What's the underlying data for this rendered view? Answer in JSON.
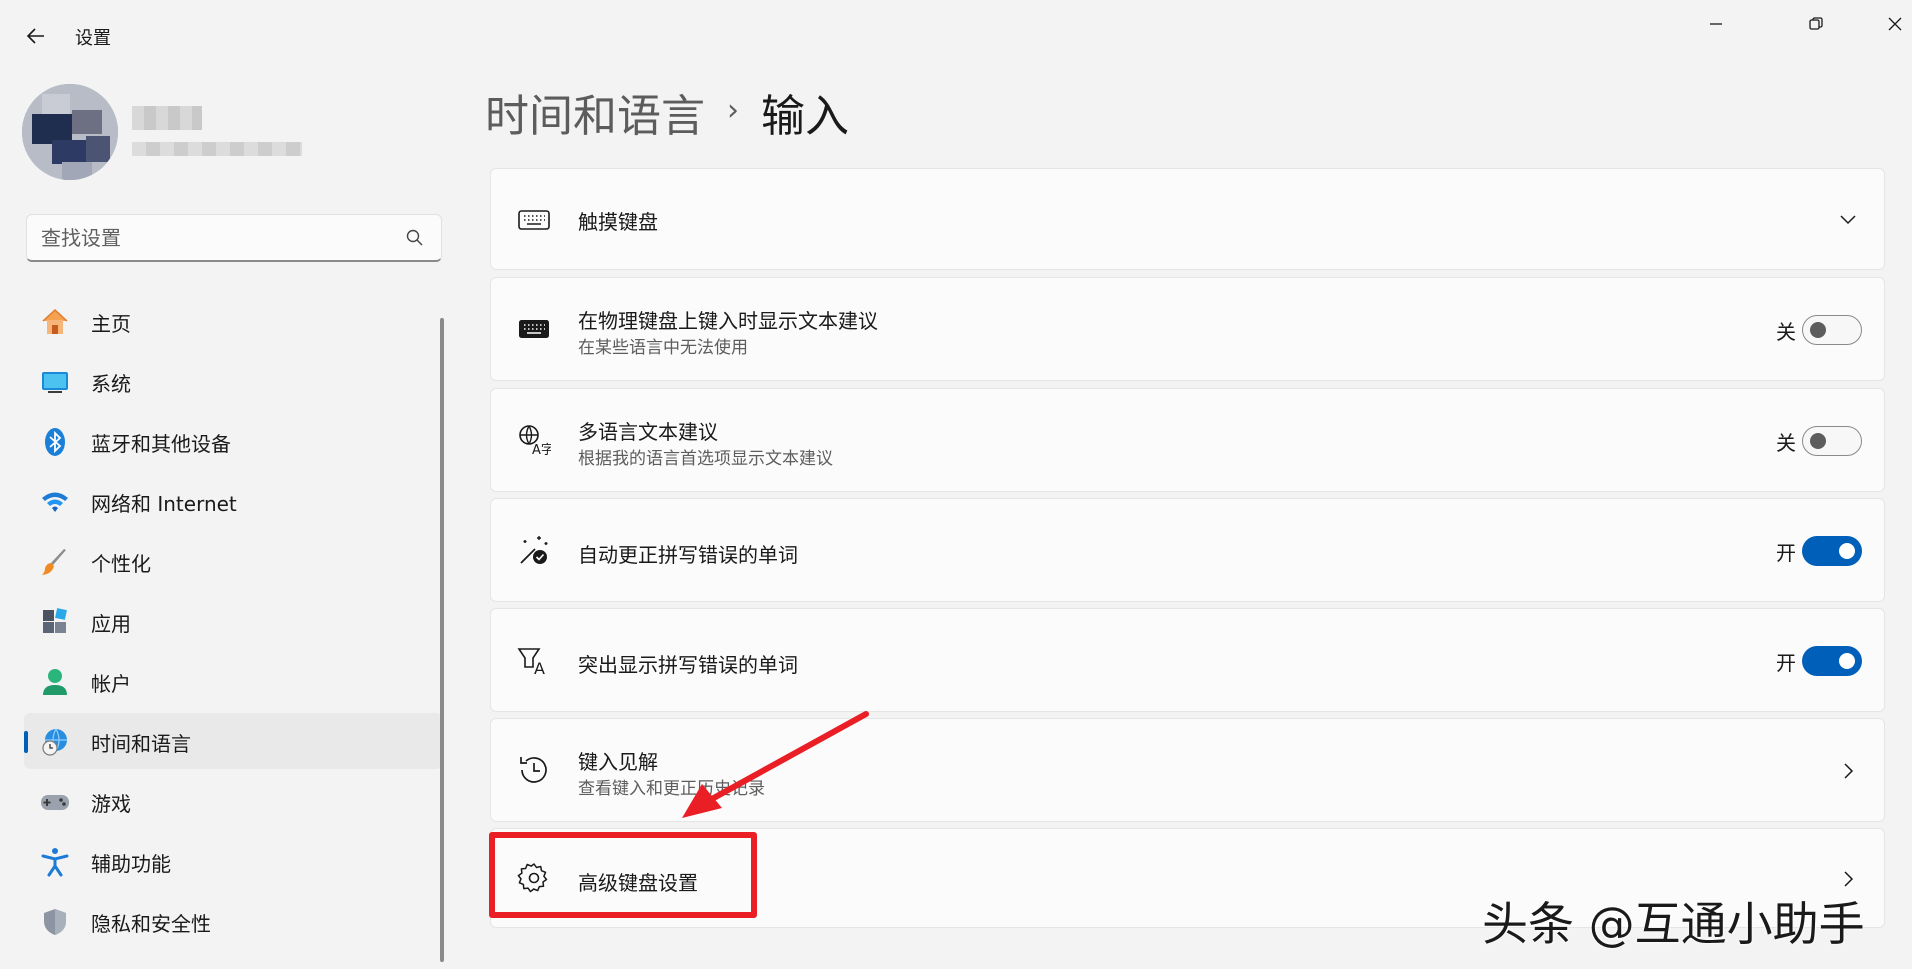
{
  "window": {
    "title": "设置"
  },
  "search": {
    "placeholder": "查找设置"
  },
  "sidebar": {
    "items": [
      {
        "label": "主页"
      },
      {
        "label": "系统"
      },
      {
        "label": "蓝牙和其他设备"
      },
      {
        "label": "网络和 Internet"
      },
      {
        "label": "个性化"
      },
      {
        "label": "应用"
      },
      {
        "label": "帐户"
      },
      {
        "label": "时间和语言",
        "active": true
      },
      {
        "label": "游戏"
      },
      {
        "label": "辅助功能"
      },
      {
        "label": "隐私和安全性"
      }
    ]
  },
  "breadcrumb": {
    "parent": "时间和语言",
    "separator": "›",
    "current": "输入"
  },
  "settings": {
    "touch_keyboard": {
      "title": "触摸键盘"
    },
    "text_suggestions": {
      "title": "在物理键盘上键入时显示文本建议",
      "subtitle": "在某些语言中无法使用",
      "state": "关",
      "on": false
    },
    "multilingual": {
      "title": "多语言文本建议",
      "subtitle": "根据我的语言首选项显示文本建议",
      "state": "关",
      "on": false
    },
    "autocorrect": {
      "title": "自动更正拼写错误的单词",
      "state": "开",
      "on": true
    },
    "highlight": {
      "title": "突出显示拼写错误的单词",
      "state": "开",
      "on": true
    },
    "typing_insights": {
      "title": "键入见解",
      "subtitle": "查看键入和更正历史记录"
    },
    "advanced_keyboard": {
      "title": "高级键盘设置"
    }
  },
  "watermark": {
    "text": "头条 @互通小助手"
  },
  "colors": {
    "accent": "#005fb8",
    "annotation": "#ea1f25"
  }
}
